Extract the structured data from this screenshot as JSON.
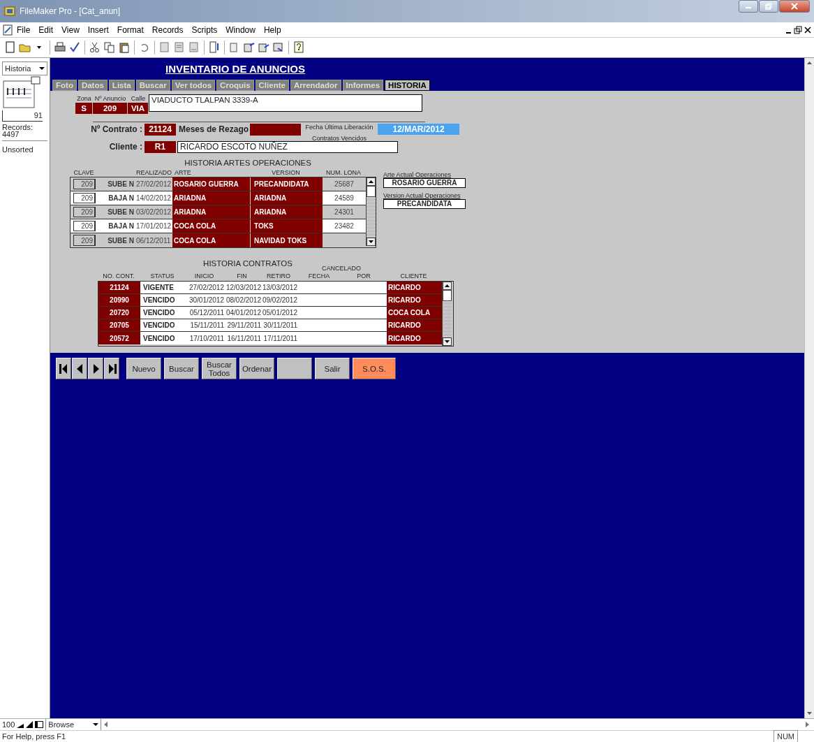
{
  "window": {
    "title": "FileMaker Pro - [Cat_anun]"
  },
  "menu": [
    "File",
    "Edit",
    "View",
    "Insert",
    "Format",
    "Records",
    "Scripts",
    "Window",
    "Help"
  ],
  "status_area": {
    "layout": "Historia",
    "record": "91",
    "records_label": "Records:",
    "records_count": "4497",
    "sort": "Unsorted"
  },
  "header": {
    "title": "INVENTARIO DE ANUNCIOS"
  },
  "tabs": [
    {
      "label": "Foto",
      "selected": false
    },
    {
      "label": "Datos",
      "selected": false
    },
    {
      "label": "Lista",
      "selected": false
    },
    {
      "label": "Buscar",
      "selected": false
    },
    {
      "label": "Ver todos",
      "selected": false
    },
    {
      "label": "Croquis",
      "selected": false
    },
    {
      "label": "Cliente",
      "selected": false
    },
    {
      "label": "Arrendador",
      "selected": false
    },
    {
      "label": "Informes",
      "selected": false
    },
    {
      "label": "HISTORIA",
      "selected": true
    }
  ],
  "anuncio": {
    "zona_label": "Zona",
    "numero_label": "Nº Anuncio",
    "calle_label": "Calle",
    "zona": "S",
    "numero": "209",
    "calle": "VIA",
    "direccion": "VIADUCTO TLALPAN  3339-A"
  },
  "contrato": {
    "label": "Nº Contrato :",
    "value": "21124",
    "rezago_label": "Meses de Rezago",
    "liberacion_label": "Fecha Última Liberación",
    "liberacion_sublabel": "Contratos Vencidos",
    "liberacion": "12/MAR/2012"
  },
  "cliente": {
    "label": "Cliente :",
    "code": "R1",
    "name": "RICARDO ESCOTO NUÑEZ"
  },
  "artes": {
    "title": "HISTORIA ARTES OPERACIONES",
    "columns": [
      "CLAVE",
      "REALIZADO",
      "ARTE",
      "VERSION",
      "NUM. LONA"
    ],
    "rows": [
      {
        "clave": "209",
        "movimiento": "SUBE N",
        "fecha": "27/02/2012",
        "arte": "ROSARIO GUERRA",
        "version": "PRECANDIDATA",
        "lona": "25687"
      },
      {
        "clave": "209",
        "movimiento": "BAJA N",
        "fecha": "14/02/2012",
        "arte": "ARIADNA",
        "version": "ARIADNA",
        "lona": "24589"
      },
      {
        "clave": "209",
        "movimiento": "SUBE N",
        "fecha": "03/02/2012",
        "arte": "ARIADNA",
        "version": "ARIADNA",
        "lona": "24301"
      },
      {
        "clave": "209",
        "movimiento": "BAJA N",
        "fecha": "17/01/2012",
        "arte": "COCA COLA",
        "version": "TOKS",
        "lona": "23482"
      },
      {
        "clave": "209",
        "movimiento": "SUBE N",
        "fecha": "06/12/2011",
        "arte": "COCA COLA",
        "version": "NAVIDAD TOKS"
      }
    ]
  },
  "actual": {
    "arte_label": "Arte Actual Operaciones",
    "arte": "ROSARIO GUERRA",
    "version_label": "Version Actual Operaciones",
    "version": "PRECANDIDATA"
  },
  "contratos": {
    "title": "HISTORIA CONTRATOS",
    "cancelado_label": "CANCELADO",
    "columns": [
      "NO. CONT.",
      "STATUS",
      "INICIO",
      "FIN",
      "RETIRO",
      "FECHA",
      "POR",
      "CLIENTE"
    ],
    "rows": [
      {
        "numero": "21124",
        "status": "VIGENTE",
        "inicio": "27/02/2012",
        "fin": "12/03/2012",
        "retiro": "13/03/2012",
        "cliente": "RICARDO"
      },
      {
        "numero": "20990",
        "status": "VENCIDO",
        "inicio": "30/01/2012",
        "fin": "08/02/2012",
        "retiro": "09/02/2012",
        "cliente": "RICARDO"
      },
      {
        "numero": "20720",
        "status": "VENCIDO",
        "inicio": "05/12/2011",
        "fin": "04/01/2012",
        "retiro": "05/01/2012",
        "cliente": "COCA COLA"
      },
      {
        "numero": "20705",
        "status": "VENCIDO",
        "inicio": "15/11/2011",
        "fin": "29/11/2011",
        "retiro": "30/11/2011",
        "cliente": "RICARDO"
      },
      {
        "numero": "20572",
        "status": "VENCIDO",
        "inicio": "17/10/2011",
        "fin": "16/11/2011",
        "retiro": "17/11/2011",
        "cliente": "RICARDO"
      }
    ]
  },
  "buttons": [
    {
      "kind": "text",
      "label": "Nuevo",
      "highlighted": false
    },
    {
      "kind": "text",
      "label": "Buscar",
      "highlighted": false
    },
    {
      "kind": "text",
      "label": "Buscar Todos",
      "highlighted": false
    },
    {
      "kind": "text",
      "label": "Ordenar",
      "highlighted": false
    },
    {
      "kind": "blank",
      "highlighted": false
    },
    {
      "kind": "text",
      "label": "Salir",
      "highlighted": false
    },
    {
      "kind": "text",
      "label": "S.O.S.",
      "highlighted": true
    }
  ],
  "bottom_bar": {
    "zoom": "100",
    "mode": "Browse"
  },
  "status_bar": {
    "help": "For Help, press F1",
    "indicator": "NUM"
  }
}
